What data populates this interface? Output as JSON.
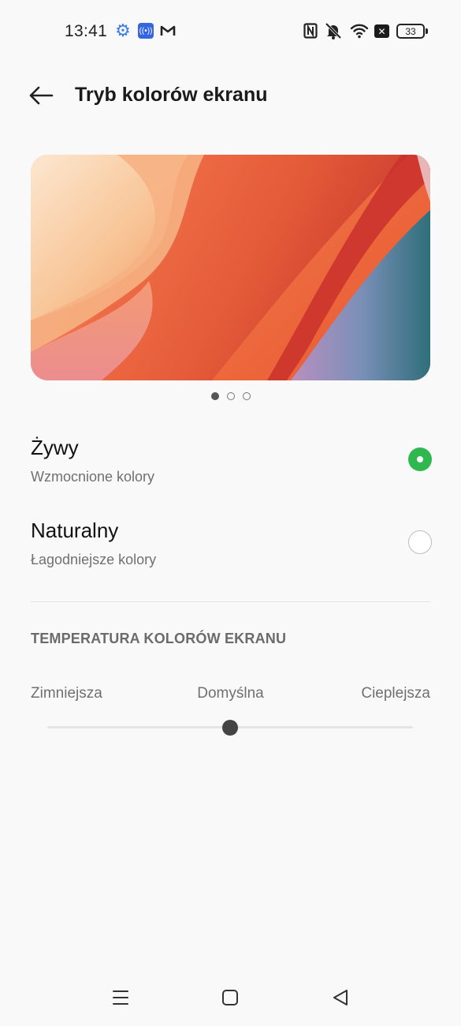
{
  "status_bar": {
    "time": "13:41",
    "battery": "33",
    "icons": [
      "gear-icon",
      "hotspot-icon",
      "gmail-icon",
      "nfc-icon",
      "mute-icon",
      "wifi-icon",
      "x-icon",
      "battery-icon"
    ]
  },
  "header": {
    "title": "Tryb kolorów ekranu",
    "back_icon": "arrow-left-icon"
  },
  "preview": {
    "pages": 3,
    "active_page": 1
  },
  "options": [
    {
      "title": "Żywy",
      "subtitle": "Wzmocnione kolory",
      "selected": true
    },
    {
      "title": "Naturalny",
      "subtitle": "Łagodniejsze kolory",
      "selected": false
    }
  ],
  "temperature": {
    "section_title": "TEMPERATURA KOLORÓW EKRANU",
    "label_cold": "Zimniejsza",
    "label_default": "Domyślna",
    "label_warm": "Cieplejsza",
    "value": 0.5
  },
  "nav_bar": {
    "icons": [
      "menu-icon",
      "home-icon",
      "back-icon"
    ]
  },
  "colors": {
    "accent_green": "#2fb84f",
    "background": "#f9f9f9"
  }
}
